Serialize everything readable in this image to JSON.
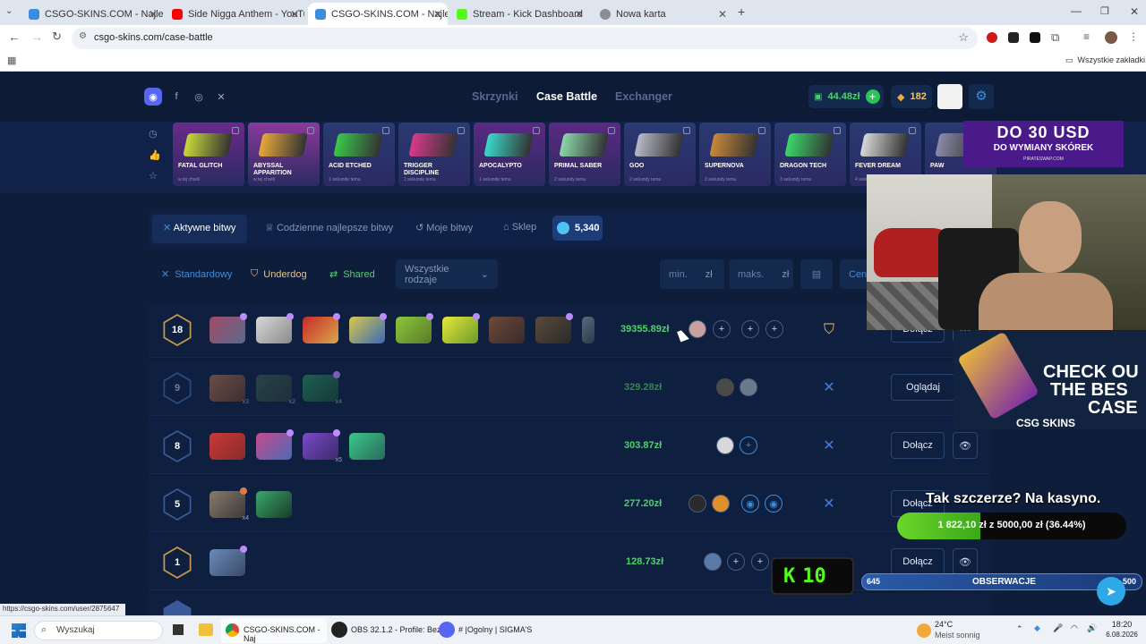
{
  "browser": {
    "tabs": [
      {
        "label": "CSGO-SKINS.COM - Najlepsze",
        "color": "#3c8dde"
      },
      {
        "label": "Side Nigga Anthem - YouTu",
        "color": "#ff0000"
      },
      {
        "label": "CSGO-SKINS.COM - Najlepsze",
        "color": "#3c8dde"
      },
      {
        "label": "Stream - Kick Dashboard",
        "color": "#53fc18"
      },
      {
        "label": "Nowa karta",
        "color": "#5f6368"
      }
    ],
    "url": "csgo-skins.com/case-battle",
    "bookmarks_all": "Wszystkie zakładki"
  },
  "header": {
    "nav": [
      "Skrzynki",
      "Case Battle",
      "Exchanger"
    ],
    "balance": "44.48zł",
    "coins": "182"
  },
  "live_drops": [
    {
      "name": "FATAL GLITCH",
      "time": "w tej chwili",
      "color": "#6a2a8a"
    },
    {
      "name": "ABYSSAL APPARITION",
      "time": "w tej chwili",
      "color": "#8a3a9a"
    },
    {
      "name": "ACID ETCHED",
      "time": "1 sekundę temu",
      "color": "#2a3a72"
    },
    {
      "name": "TRIGGER DISCIPLINE",
      "time": "1 sekundę temu",
      "color": "#2a3a72"
    },
    {
      "name": "APOCALYPTO",
      "time": "1 sekundę temu",
      "color": "#5a2a82"
    },
    {
      "name": "PRIMAL SABER",
      "time": "2 sekundy temu",
      "color": "#5a2a82"
    },
    {
      "name": "GOO",
      "time": "2 sekundy temu",
      "color": "#2a3a72"
    },
    {
      "name": "SUPERNOVA",
      "time": "3 sekundy temu",
      "color": "#2a3a72"
    },
    {
      "name": "DRAGON TECH",
      "time": "3 sekundy temu",
      "color": "#2a3a72"
    },
    {
      "name": "FEVER DREAM",
      "time": "4 sekundy temu",
      "color": "#2a3a72"
    },
    {
      "name": "PAW",
      "time": "",
      "color": "#2a3a72"
    }
  ],
  "ad_top": {
    "line1": "DO 30 USD",
    "line2": "DO WYMIANY SKÓREK",
    "line3": "PIRATESWAP.COM"
  },
  "tabs": {
    "active": "Aktywne bitwy",
    "daily": "Codzienne najlepsze bitwy",
    "mine": "Moje bitwy",
    "shop": "Sklep",
    "gems": "5,340"
  },
  "filters": {
    "standard": "Standardowy",
    "underdog": "Underdog",
    "shared": "Shared",
    "all_types": "Wszystkie rodzaje",
    "min": "min.",
    "max": "maks.",
    "currency": "zł",
    "sort": "Cen"
  },
  "battles": [
    {
      "count": "18",
      "price": "39355.89zł",
      "action": "Dołącz",
      "avatars": 1,
      "slots": 3,
      "gold": true
    },
    {
      "count": "9",
      "price": "329.28zł",
      "action": "Oglądaj",
      "avatars": 2,
      "slots": 0,
      "gold": false
    },
    {
      "count": "8",
      "price": "303.87zł",
      "action": "Dołącz",
      "avatars": 1,
      "slots": 1,
      "gold": false
    },
    {
      "count": "5",
      "price": "277.20zł",
      "action": "Dołącz",
      "avatars": 2,
      "slots": 2,
      "gold": false
    },
    {
      "count": "1",
      "price": "128.73zł",
      "action": "Dołącz",
      "avatars": 1,
      "slots": 2,
      "gold": true
    }
  ],
  "mults": {
    "r2c1": "x3",
    "r2c2": "x2",
    "r2c3": "x4",
    "r3c3": "x5",
    "r4c1": "x4"
  },
  "promo": {
    "line1": "CHECK OU",
    "line2": "THE BES",
    "line3": "CASE",
    "brand": "CSG SKINS"
  },
  "overlay": {
    "question": "Tak szczerze? Na kasyno.",
    "progress_text": "1 822,10 zł z 5000,00 zł (36.44%)",
    "progress_fraction": 0.3644,
    "kick_counter": "10",
    "obs_left": "645",
    "obs_label": "OBSERWACJE",
    "obs_right": "500"
  },
  "status_url": "https://csgo-skins.com/user/2875647",
  "taskbar": {
    "search": "Wyszukaj",
    "chrome": "CSGO-SKINS.COM - Naj",
    "obs": "OBS 32.1.2 - Profile: Bez",
    "discord": "#  |Ogolny | SIGMA'S",
    "temp": "24°C",
    "weather": "Meist sonnig",
    "time": "18:20",
    "date": "6.08.2026"
  }
}
